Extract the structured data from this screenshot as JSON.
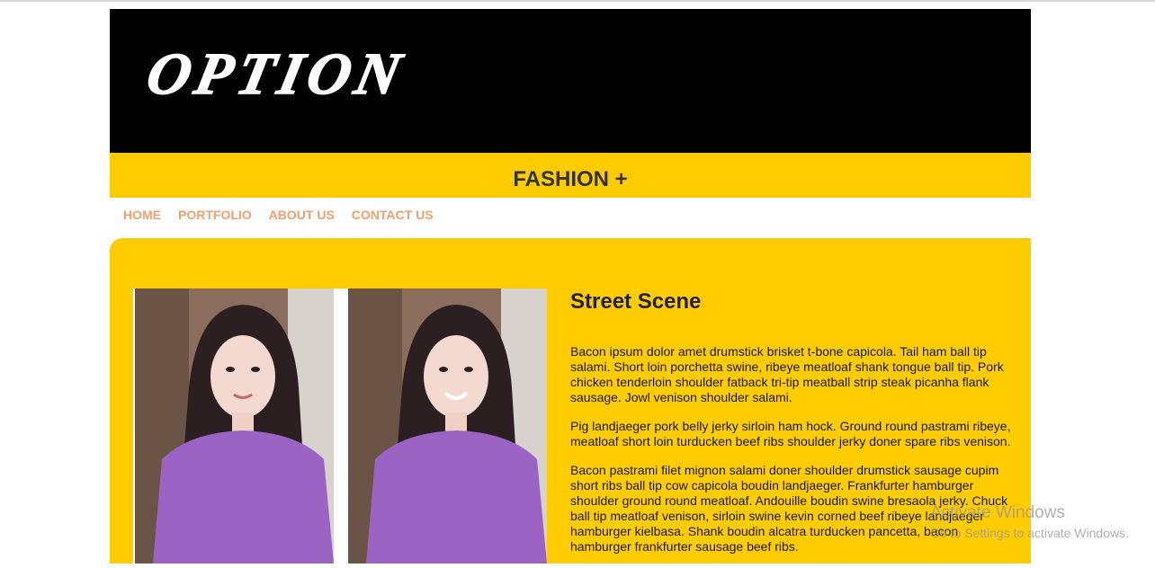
{
  "header": {
    "logo_text": "OPTION",
    "tagline": "FASHION +"
  },
  "nav": {
    "items": [
      "HOME",
      "PORTFOLIO",
      "ABOUT US",
      "CONTACT US"
    ]
  },
  "article": {
    "title": "Street Scene",
    "paragraphs": [
      "Bacon ipsum dolor amet drumstick brisket t-bone capicola. Tail ham ball tip salami. Short loin porchetta swine, ribeye meatloaf shank tongue ball tip. Pork chicken tenderloin shoulder fatback tri-tip meatball strip steak picanha flank sausage. Jowl venison shoulder salami.",
      "Pig landjaeger pork belly jerky sirloin ham hock. Ground round pastrami ribeye, meatloaf short loin turducken beef ribs shoulder jerky doner spare ribs venison.",
      "Bacon pastrami filet mignon salami doner shoulder drumstick sausage cupim short ribs ball tip cow capicola boudin landjaeger. Frankfurter hamburger shoulder ground round meatloaf. Andouille boudin swine bresaola jerky. Chuck ball tip meatloaf venison, sirloin swine kevin corned beef ribeye landjaeger hamburger kielbasa. Shank boudin alcatra turducken pancetta, bacon hamburger frankfurter sausage beef ribs."
    ]
  },
  "watermark": {
    "line1": "Activate Windows",
    "line2": "Go to Settings to activate Windows."
  },
  "colors": {
    "banner": "#000000",
    "accent": "#ffcc00",
    "nav_link": "#f0a070"
  }
}
